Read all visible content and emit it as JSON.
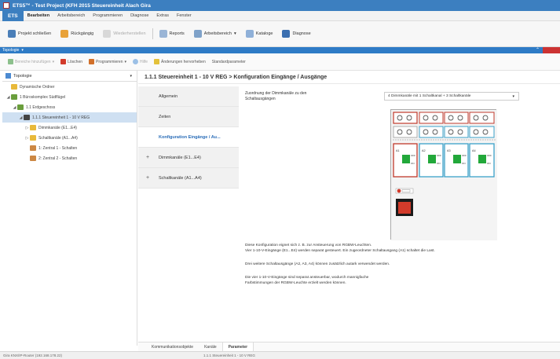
{
  "window": {
    "title": "ETS5™ - Test Project (KFH 2015 Steuereinheit Alach Gira"
  },
  "menubar": {
    "ets": "ETS",
    "items": [
      "Bearbeiten",
      "Arbeitsbereich",
      "Programmieren",
      "Diagnose",
      "Extras",
      "Fenster"
    ]
  },
  "toolbar": {
    "open_project": "Projekt schließen",
    "undo": "Rückgängig",
    "redo": "Wiederherstellen",
    "reports": "Reports",
    "workspace": "Arbeitsbereich",
    "catalogs": "Kataloge",
    "diagnosis": "Diagnose"
  },
  "panel": {
    "title": "Topologie"
  },
  "toolbar2": {
    "add_lines": "Bereiche hinzufügen",
    "delete": "Löschen",
    "program": "Programmieren",
    "help": "Hilfe",
    "highlight": "Änderungen hervorheben",
    "default_params": "Standardparameter"
  },
  "tree": {
    "header": "Topologie",
    "items": [
      {
        "label": "Dynamische Ordner",
        "level": 0,
        "exp": "",
        "color": "#e8b93a"
      },
      {
        "label": "1 Büroskomplex Südflügel",
        "level": 0,
        "exp": "◢",
        "color": "#6a9e3c"
      },
      {
        "label": "1.1 Erdgeschoss",
        "level": 1,
        "exp": "◢",
        "color": "#6a9e3c"
      },
      {
        "label": "1.1.1 Steuereinheit 1 - 10 V REG",
        "level": 2,
        "exp": "◢",
        "color": "#444",
        "selected": true
      },
      {
        "label": "Dimmkanäle (E1...E4)",
        "level": 3,
        "exp": "▷",
        "color": "#e8b93a"
      },
      {
        "label": "Schaltkanäle (A1...A4)",
        "level": 3,
        "exp": "▷",
        "color": "#e8b93a"
      },
      {
        "label": "1: Zentral 1 - Schalten",
        "level": 3,
        "exp": "",
        "color": "#c84"
      },
      {
        "label": "2: Zentral 2 - Schalten",
        "level": 3,
        "exp": "",
        "color": "#c84"
      }
    ]
  },
  "main": {
    "title": "1.1.1 Steuereinheit 1 - 10 V REG > Konfiguration Eingänge / Ausgänge"
  },
  "nav": [
    {
      "label": "Allgemein",
      "plus": "",
      "active": false
    },
    {
      "label": "Zeiten",
      "plus": "",
      "active": false
    },
    {
      "label": "Konfiguration Eingänge / Au...",
      "plus": "",
      "active": true
    },
    {
      "label": "Dimmkanäle (E1...E4)",
      "plus": "+",
      "active": false
    },
    {
      "label": "Schaltkanäle (A1...A4)",
      "plus": "+",
      "active": false
    }
  ],
  "content": {
    "assign_label": "Zuordnung der Dimmkanäle zu den Schaltausgängen",
    "select_value": "4 Dimmkanäle mit 1 Schaltkanal + 3 Schaltkanäle",
    "p1a": "Diese Konfiguration eignet sich z. B. zur Ansteuerung von RGBW-Leuchten.",
    "p1b": "Vier 1-10-V-Eingänge (E1...E4) werden separat gesteuert. Ein zugeordneter Schaltausgang (A1) schaltet die Last.",
    "p2": "Drei weitere Schaltausgänge (A2, A3, A4) können zusätzlich autark verwendet werden.",
    "p3a": "Die vier 1-10-V-Eingänge sind separat ansteuerbar, wodurch mannigfache",
    "p3b": "Farbstimmungen der RGBW-Leuchte erzielt werden können."
  },
  "device": {
    "channels": [
      "A1",
      "A2",
      "A3",
      "A4"
    ],
    "on_label": "ON",
    "off_label": "OFF"
  },
  "bottom_tabs": [
    "Kommunikationsobjekte",
    "Kanäle",
    "Parameter"
  ],
  "status": {
    "left": "Gira KNX/IP-Router (192.168.178.22)",
    "center": "1.1.1 Steuereinheit 1 - 10 V REG"
  }
}
